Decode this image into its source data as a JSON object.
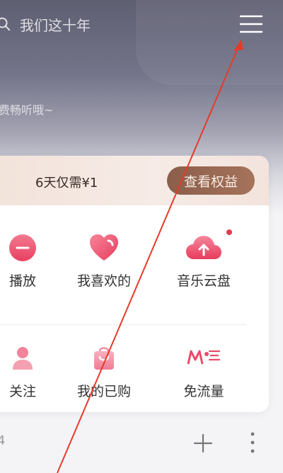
{
  "search": {
    "placeholder": "我们这十年",
    "icon": "search-icon"
  },
  "hero": {
    "subtitle": "费畅听哦~"
  },
  "vip": {
    "text": "6天仅需¥1",
    "button_label": "查看权益"
  },
  "grid": {
    "row1": [
      {
        "label": "播放",
        "icon": "play-icon"
      },
      {
        "label": "我喜欢的",
        "icon": "heart-icon"
      },
      {
        "label": "音乐云盘",
        "icon": "cloud-upload-icon"
      }
    ],
    "row2": [
      {
        "label": "关注",
        "icon": "follow-icon"
      },
      {
        "label": "我的已购",
        "icon": "shopping-bag-icon"
      },
      {
        "label": "免流量",
        "icon": "mobile-data-icon"
      }
    ]
  },
  "bottom": {
    "left_text": "4"
  },
  "colors": {
    "accent": "#e94b6a",
    "vip_button": "#9a6a54",
    "annotation": "#e53a2a"
  }
}
